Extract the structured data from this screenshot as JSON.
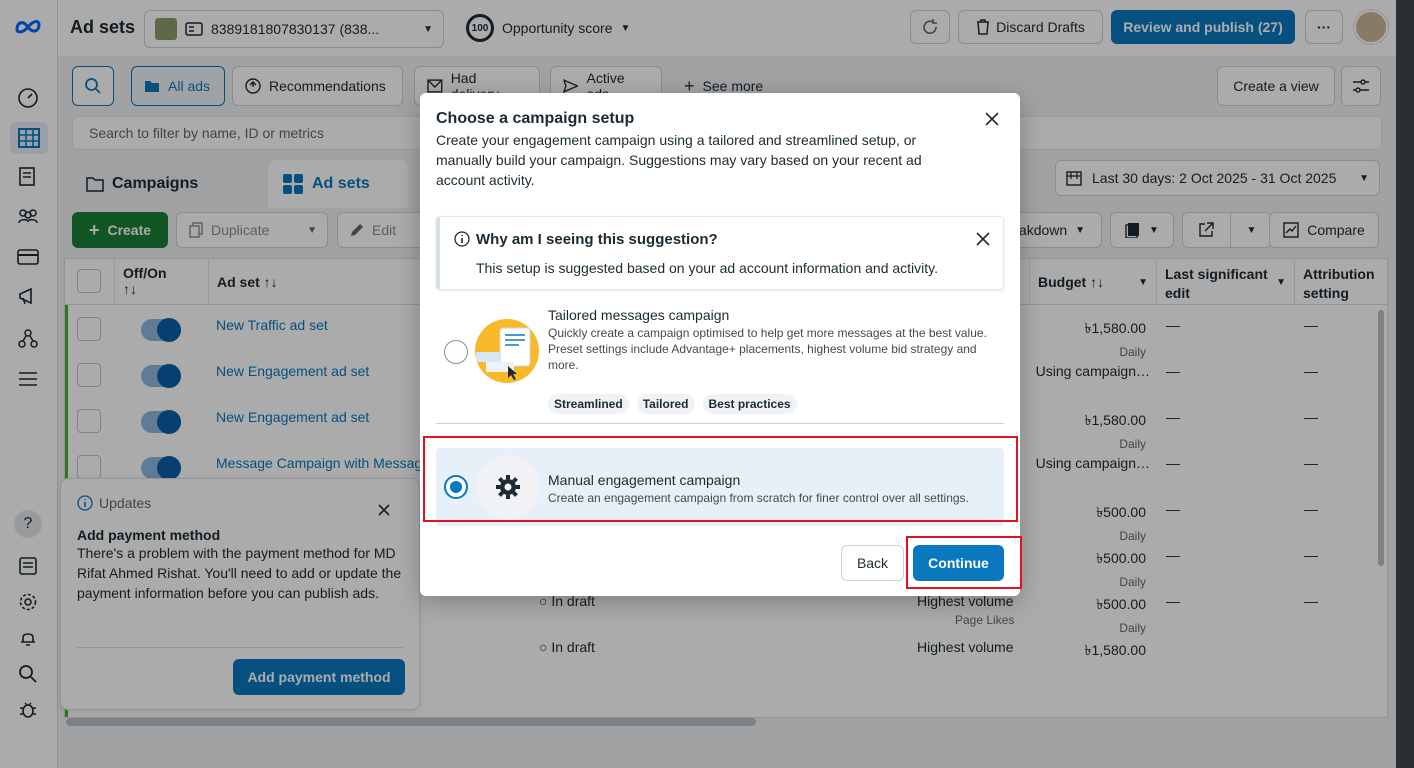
{
  "header": {
    "title": "Ad sets",
    "account_label": "8389181807830137 (838...",
    "opportunity_score_value": "100",
    "opportunity_score_label": "Opportunity score",
    "discard_label": "Discard Drafts",
    "review_label": "Review and publish (27)",
    "more_label": "···"
  },
  "filters": {
    "all_ads": "All ads",
    "recommendations": "Recommendations",
    "had_delivery": "Had delivery",
    "active_ads": "Active ads",
    "see_more": "See more",
    "create_view": "Create a view",
    "search_placeholder": "Search to filter by name, ID or metrics"
  },
  "tabs": {
    "campaigns": "Campaigns",
    "adsets": "Ad sets",
    "date_range": "Last 30 days: 2 Oct 2025 - 31 Oct 2025"
  },
  "actions": {
    "create": "Create",
    "duplicate": "Duplicate",
    "edit": "Edit",
    "breakdown": "akdown",
    "compare": "Compare"
  },
  "table": {
    "headers": {
      "off_on": "Off/On",
      "sort": "↑↓",
      "adset": "Ad set ↑↓",
      "budget": "Budget ↑↓",
      "last_edit": "Last significant edit",
      "attribution": "Attribution setting"
    },
    "rows": [
      {
        "name": "New Traffic ad set",
        "budget": "৳1,580.00",
        "budget_period": "Daily",
        "last_edit": "—",
        "attribution": "—"
      },
      {
        "name": "New Engagement ad set",
        "budget": "Using campaign…",
        "budget_period": "",
        "last_edit": "—",
        "attribution": "—"
      },
      {
        "name": "New Engagement ad set",
        "budget": "৳1,580.00",
        "budget_period": "Daily",
        "last_edit": "—",
        "attribution": "—"
      },
      {
        "name": "Message Campaign with Messag",
        "budget": "Using campaign…",
        "budget_period": "",
        "last_edit": "—",
        "attribution": "—"
      },
      {
        "name": "",
        "budget": "৳500.00",
        "budget_period": "Daily",
        "last_edit": "—",
        "attribution": "—"
      },
      {
        "name": "",
        "budget": "৳500.00",
        "budget_period": "Daily",
        "last_edit": "—",
        "attribution": "—"
      },
      {
        "name": "",
        "budget": "৳500.00",
        "budget_period": "Daily",
        "last_edit": "—",
        "attribution": "—"
      },
      {
        "name": "",
        "budget": "৳1,580.00",
        "budget_period": "",
        "last_edit": "",
        "attribution": ""
      }
    ],
    "row_extra": {
      "status_in_draft": "In draft",
      "bid_highest": "Highest volume",
      "page_likes": "Page Likes"
    }
  },
  "updates": {
    "header": "Updates",
    "title": "Add payment method",
    "body": "There's a problem with the payment method for MD Rifat Ahmed Rishat. You'll need to add or update the payment information before you can publish ads.",
    "button": "Add payment method"
  },
  "modal": {
    "title": "Choose a campaign setup",
    "description": "Create your engagement campaign using a tailored and streamlined setup, or manually build your campaign. Suggestions may vary based on your recent ad account activity.",
    "info_title": "Why am I seeing this suggestion?",
    "info_text": "This setup is suggested based on your ad account information and activity.",
    "option1_title": "Tailored messages campaign",
    "option1_desc": "Quickly create a campaign optimised to help get more messages at the best value. Preset settings include Advantage+ placements, highest volume bid strategy and more.",
    "option1_tags": [
      "Streamlined",
      "Tailored",
      "Best practices"
    ],
    "option2_title": "Manual engagement campaign",
    "option2_desc": "Create an engagement campaign from scratch for finer control over all settings.",
    "selected_option": "Manual engagement campaign",
    "back_label": "Back",
    "continue_label": "Continue"
  },
  "colors": {
    "accent": "#0a78be",
    "create_green": "#1a7f37",
    "highlight_red": "#e0141e"
  }
}
